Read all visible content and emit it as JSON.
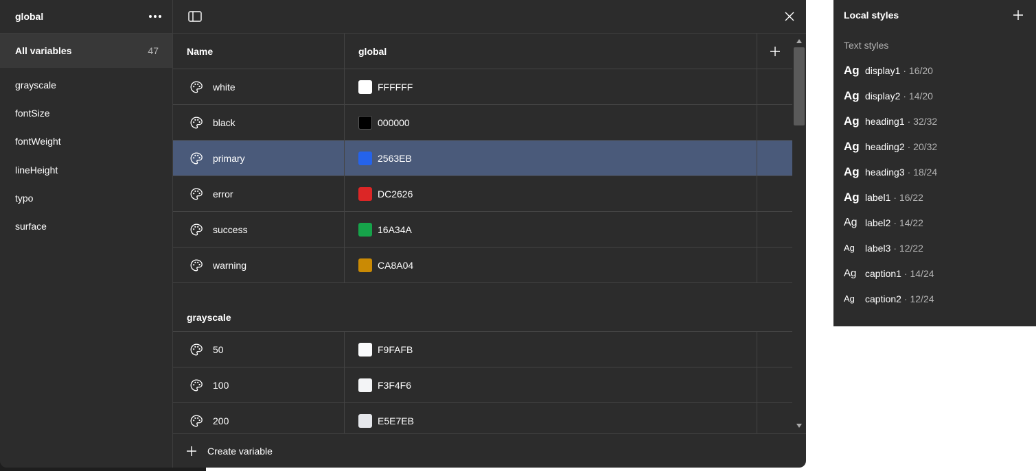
{
  "sidebar": {
    "title": "global",
    "all_label": "All variables",
    "all_count": "47",
    "groups": [
      "grayscale",
      "fontSize",
      "fontWeight",
      "lineHeight",
      "typo",
      "surface"
    ]
  },
  "table": {
    "col_name": "Name",
    "col_mode": "global",
    "rows": [
      {
        "name": "white",
        "value": "FFFFFF",
        "color": "#FFFFFF"
      },
      {
        "name": "black",
        "value": "000000",
        "color": "#000000"
      },
      {
        "name": "primary",
        "value": "2563EB",
        "color": "#2563EB"
      },
      {
        "name": "error",
        "value": "DC2626",
        "color": "#DC2626"
      },
      {
        "name": "success",
        "value": "16A34A",
        "color": "#16A34A"
      },
      {
        "name": "warning",
        "value": "CA8A04",
        "color": "#CA8A04"
      }
    ],
    "group_title": "grayscale",
    "group_rows": [
      {
        "name": "50",
        "value": "F9FAFB",
        "color": "#F9FAFB"
      },
      {
        "name": "100",
        "value": "F3F4F6",
        "color": "#F3F4F6"
      },
      {
        "name": "200",
        "value": "E5E7EB",
        "color": "#E5E7EB"
      }
    ]
  },
  "footer": {
    "create_label": "Create variable"
  },
  "styles_panel": {
    "title": "Local styles",
    "subtitle": "Text styles",
    "items": [
      {
        "name": "display1",
        "meta": "· 16/20"
      },
      {
        "name": "display2",
        "meta": "· 14/20"
      },
      {
        "name": "heading1",
        "meta": "· 32/32"
      },
      {
        "name": "heading2",
        "meta": "· 20/32"
      },
      {
        "name": "heading3",
        "meta": "· 18/24"
      },
      {
        "name": "label1",
        "meta": "· 16/22"
      },
      {
        "name": "label2",
        "meta": "· 14/22"
      },
      {
        "name": "label3",
        "meta": "· 12/22"
      },
      {
        "name": "caption1",
        "meta": "· 14/24"
      },
      {
        "name": "caption2",
        "meta": "· 12/24"
      }
    ],
    "ag": "Ag"
  },
  "colors": {
    "dialog_bg": "#2c2c2c",
    "selected_row": "#4a5a7a",
    "sidebar_active": "#383838"
  }
}
